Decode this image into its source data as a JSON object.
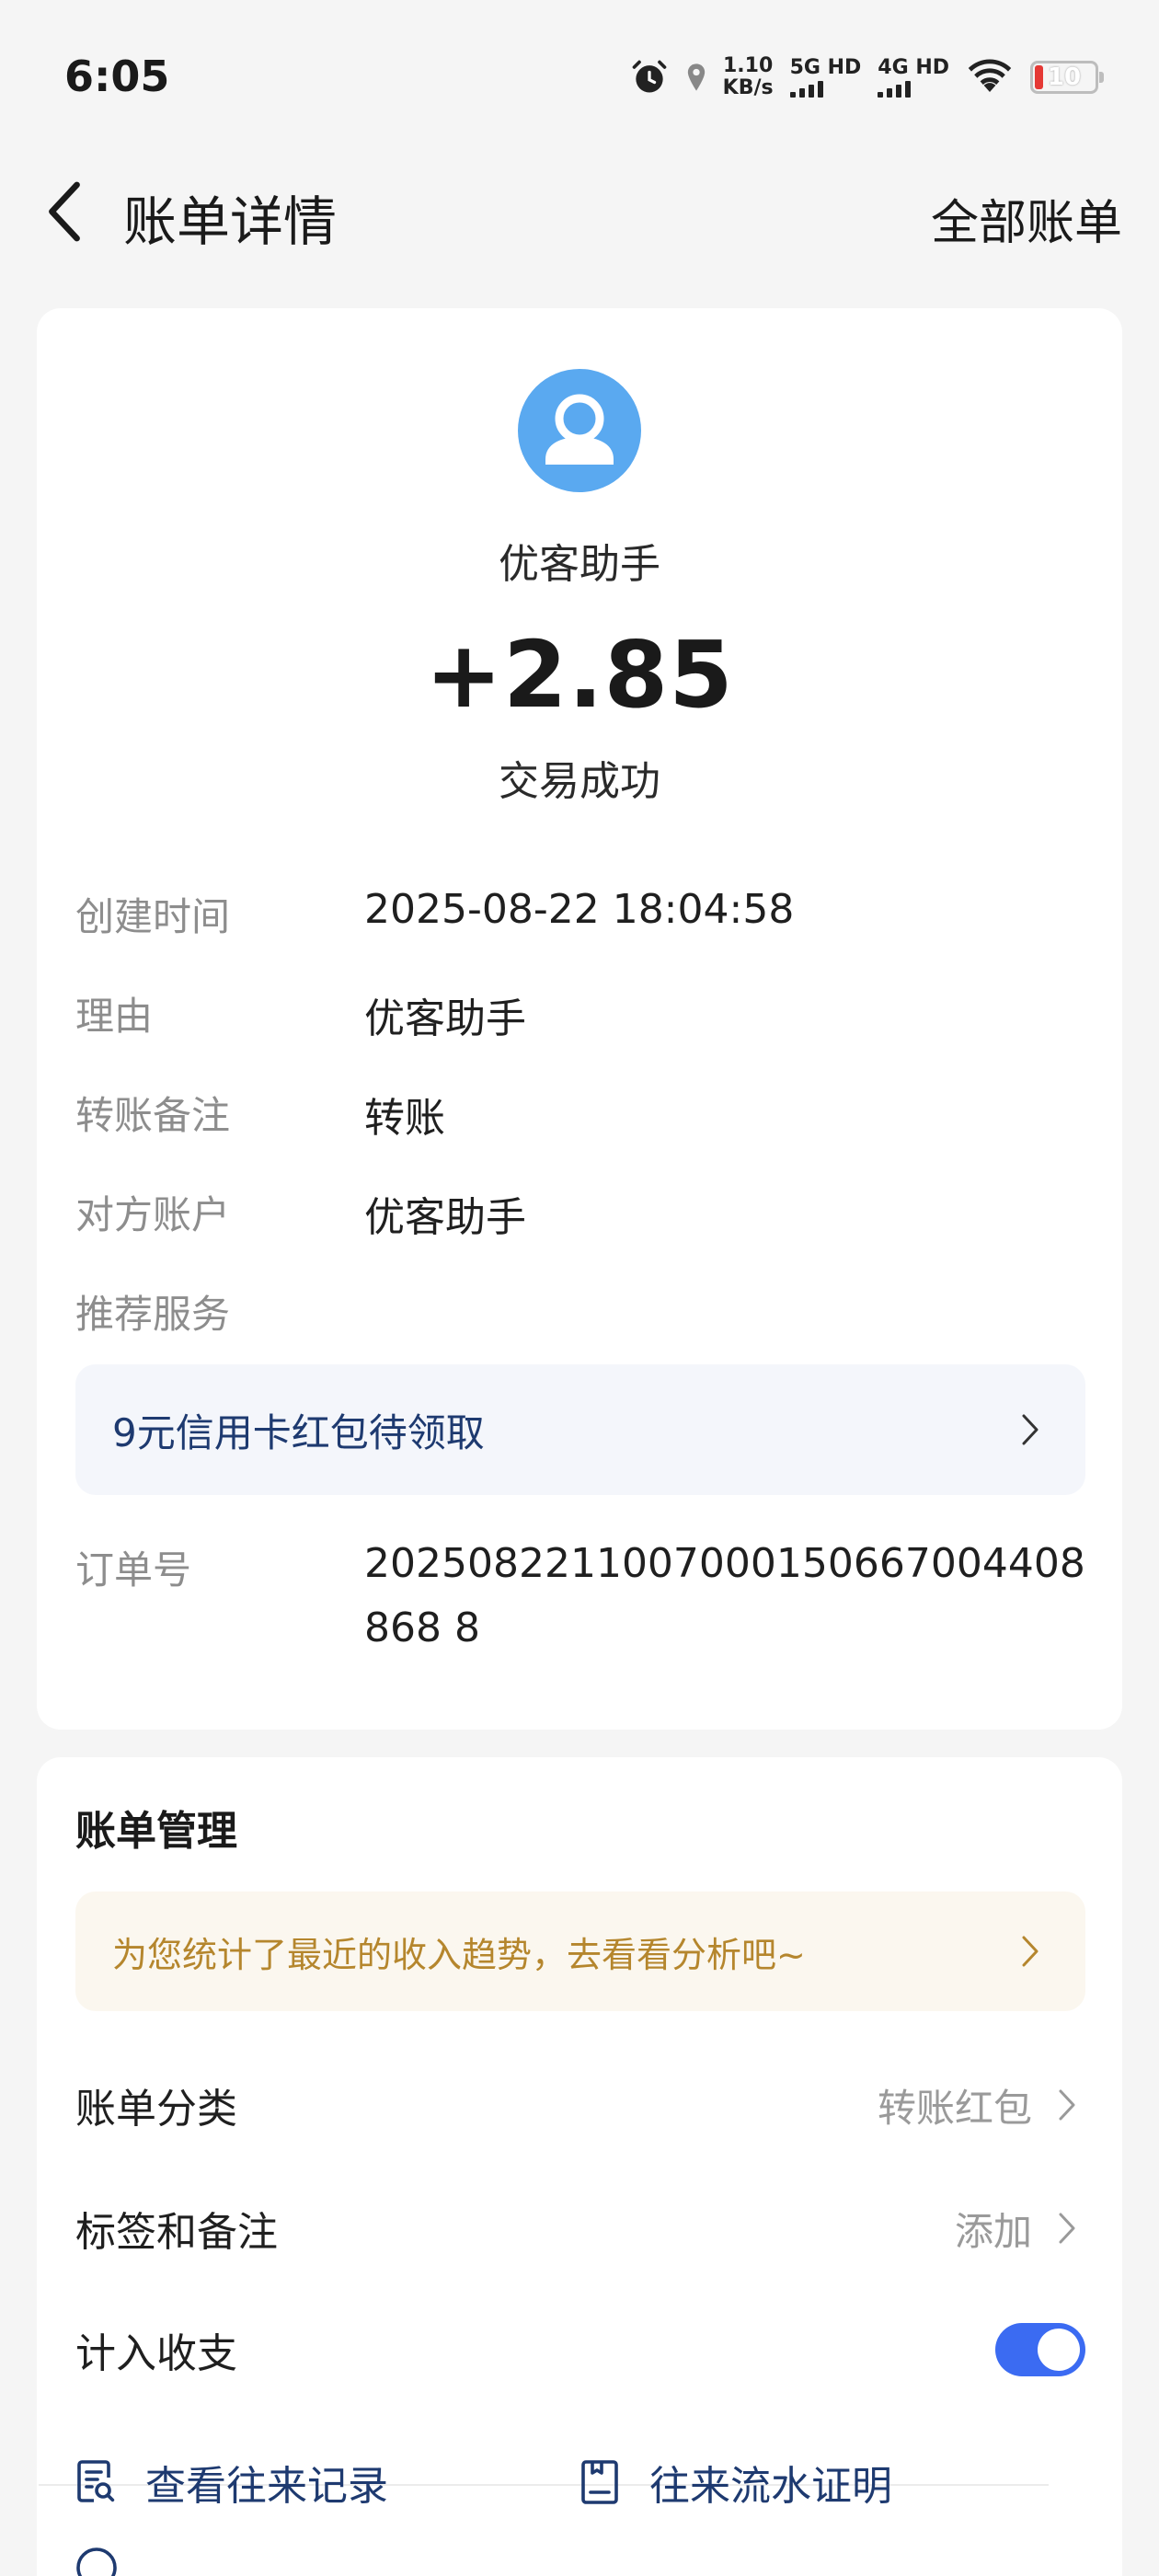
{
  "status_bar": {
    "time": "6:05",
    "speed_value": "1.10",
    "speed_unit": "KB/s",
    "net1": "5G HD",
    "net2": "4G HD",
    "battery": "10"
  },
  "header": {
    "title": "账单详情",
    "all_bills": "全部账单"
  },
  "summary": {
    "payee": "优客助手",
    "amount": "+2.85",
    "status": "交易成功"
  },
  "details": {
    "created_label": "创建时间",
    "created_value": "2025-08-22 18:04:58",
    "reason_label": "理由",
    "reason_value": "优客助手",
    "memo_label": "转账备注",
    "memo_value": "转账",
    "counterparty_label": "对方账户",
    "counterparty_value": "优客助手",
    "recommend_label": "推荐服务",
    "promo_text": "9元信用卡红包待领取",
    "order_label": "订单号",
    "order_value": "2025082211007000150667004408868 8"
  },
  "management": {
    "title": "账单管理",
    "insight_text": "为您统计了最近的收入趋势，去看看分析吧~",
    "category_label": "账单分类",
    "category_value": "转账红包",
    "tags_label": "标签和备注",
    "tags_value": "添加",
    "include_label": "计入收支",
    "include_enabled": true,
    "records_link": "查看往来记录",
    "proof_link": "往来流水证明"
  },
  "colors": {
    "accent_blue": "#3b6bf2",
    "avatar_blue": "#5aa9f0",
    "link_navy": "#1e3a70",
    "insight_gold": "#b5862d"
  }
}
